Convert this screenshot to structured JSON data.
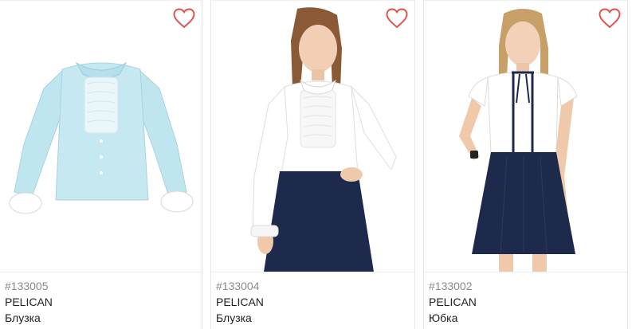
{
  "colors": {
    "heart": "#e0524e",
    "sku_text": "#8a8a8a",
    "text": "#222222",
    "blouse_light_blue": "#bfe5ef",
    "blouse_white": "#ffffff",
    "skirt_navy": "#1d2a4c"
  },
  "icons": {
    "favorite": "heart-outline-icon"
  },
  "products": [
    {
      "sku": "#133005",
      "brand": "PELICAN",
      "type": "Блузка"
    },
    {
      "sku": "#133004",
      "brand": "PELICAN",
      "type": "Блузка"
    },
    {
      "sku": "#133002",
      "brand": "PELICAN",
      "type": "Юбка"
    }
  ]
}
